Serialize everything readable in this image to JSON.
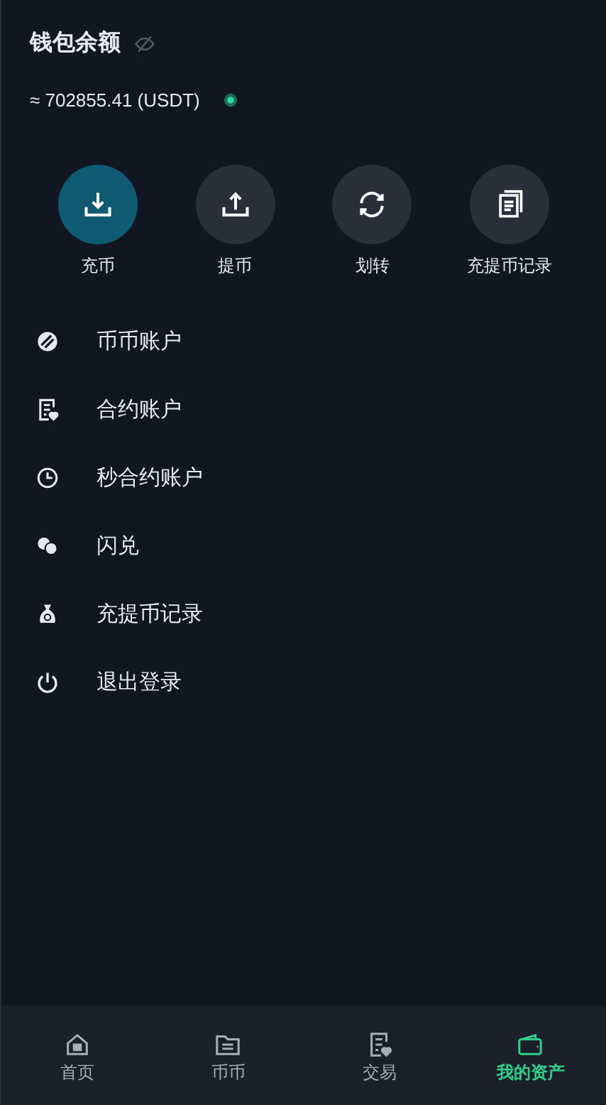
{
  "balance": {
    "title": "钱包余额",
    "amount": "≈ 702855.41 (USDT)"
  },
  "actions": [
    {
      "label": "充币",
      "selected": true
    },
    {
      "label": "提币",
      "selected": false
    },
    {
      "label": "划转",
      "selected": false
    },
    {
      "label": "充提币记录",
      "selected": false
    }
  ],
  "menu": [
    {
      "label": "币币账户"
    },
    {
      "label": "合约账户"
    },
    {
      "label": "秒合约账户"
    },
    {
      "label": "闪兑"
    },
    {
      "label": "充提币记录"
    },
    {
      "label": "退出登录"
    }
  ],
  "tabbar": [
    {
      "label": "首页",
      "selected": false
    },
    {
      "label": "币币",
      "selected": false
    },
    {
      "label": "交易",
      "selected": false
    },
    {
      "label": "我的资产",
      "selected": true
    }
  ]
}
